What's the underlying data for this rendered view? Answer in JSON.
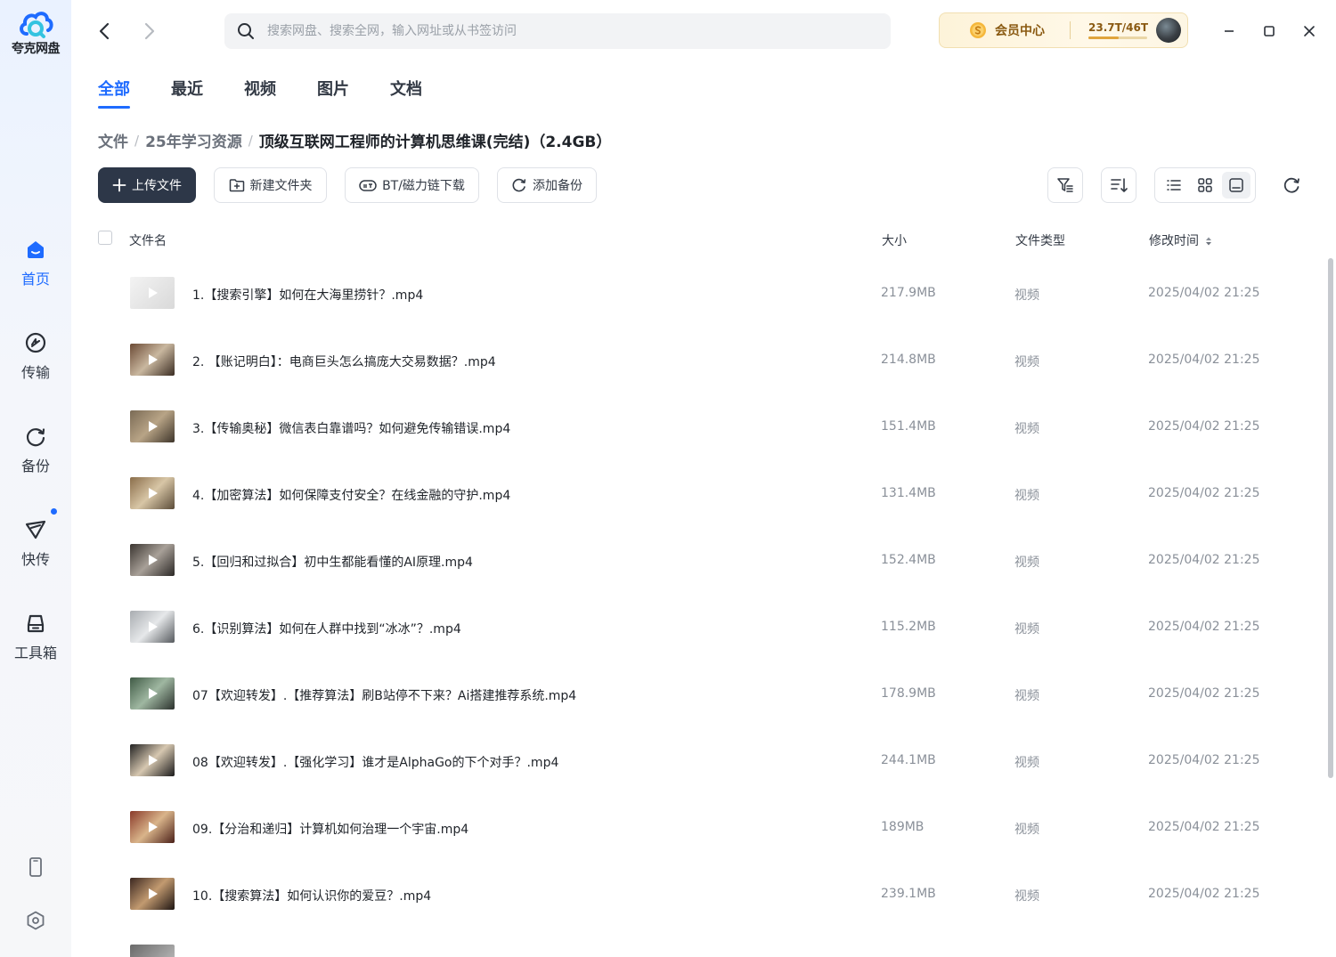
{
  "app": {
    "name": "夸克网盘"
  },
  "sidebar": {
    "items": [
      {
        "label": "首页",
        "icon": "home-icon",
        "active": true
      },
      {
        "label": "传输",
        "icon": "transfer-icon",
        "active": false
      },
      {
        "label": "备份",
        "icon": "backup-icon",
        "active": false
      },
      {
        "label": "快传",
        "icon": "send-icon",
        "active": false,
        "badge": true
      },
      {
        "label": "工具箱",
        "icon": "toolbox-icon",
        "active": false
      }
    ],
    "bottom": [
      {
        "icon": "phone-icon"
      },
      {
        "icon": "settings-icon"
      }
    ]
  },
  "search": {
    "placeholder": "搜索网盘、搜索全网，输入网址或从书签访问"
  },
  "vip": {
    "label": "会员中心",
    "quota": "23.7T/46T",
    "used_fraction": 0.515
  },
  "tabs": [
    {
      "label": "全部",
      "active": true
    },
    {
      "label": "最近",
      "active": false
    },
    {
      "label": "视频",
      "active": false
    },
    {
      "label": "图片",
      "active": false
    },
    {
      "label": "文档",
      "active": false
    }
  ],
  "breadcrumb": {
    "items": [
      "文件",
      "25年学习资源"
    ],
    "separator": "/",
    "current": "顶级互联网工程师的计算机思维课(完结)（2.4GB）"
  },
  "toolbar": {
    "upload": "上传文件",
    "new_folder": "新建文件夹",
    "bt": "BT/磁力链下载",
    "backup": "添加备份"
  },
  "table": {
    "headers": {
      "name": "文件名",
      "size": "大小",
      "type": "文件类型",
      "time": "修改时间"
    },
    "rows": [
      {
        "name": "1.【搜索引擎】如何在大海里捞针？.mp4",
        "size": "217.9MB",
        "type": "视频",
        "time": "2025/04/02 21:25"
      },
      {
        "name": "2. 【账记明白】：电商巨头怎么搞庞大交易数据？.mp4",
        "size": "214.8MB",
        "type": "视频",
        "time": "2025/04/02 21:25"
      },
      {
        "name": "3.【传输奥秘】微信表白靠谱吗？如何避免传输错误.mp4",
        "size": "151.4MB",
        "type": "视频",
        "time": "2025/04/02 21:25"
      },
      {
        "name": "4.【加密算法】如何保障支付安全？在线金融的守护.mp4",
        "size": "131.4MB",
        "type": "视频",
        "time": "2025/04/02 21:25"
      },
      {
        "name": "5.【回归和过拟合】初中生都能看懂的AI原理.mp4",
        "size": "152.4MB",
        "type": "视频",
        "time": "2025/04/02 21:25"
      },
      {
        "name": "6.【识别算法】如何在人群中找到“冰冰”？.mp4",
        "size": "115.2MB",
        "type": "视频",
        "time": "2025/04/02 21:25"
      },
      {
        "name": "07【欢迎转发】.【推荐算法】刷B站停不下来？Ai搭建推荐系统.mp4",
        "size": "178.9MB",
        "type": "视频",
        "time": "2025/04/02 21:25"
      },
      {
        "name": "08【欢迎转发】.【强化学习】谁才是AlphaGo的下个对手？.mp4",
        "size": "244.1MB",
        "type": "视频",
        "time": "2025/04/02 21:25"
      },
      {
        "name": "09.【分治和递归】计算机如何治理一个宇宙.mp4",
        "size": "189MB",
        "type": "视频",
        "time": "2025/04/02 21:25"
      },
      {
        "name": "10.【搜索算法】如何认识你的爱豆？.mp4",
        "size": "239.1MB",
        "type": "视频",
        "time": "2025/04/02 21:25"
      }
    ]
  },
  "colors": {
    "accent": "#1e6bff",
    "primary_button": "#2d3748",
    "vip_text": "#8a5a12"
  }
}
